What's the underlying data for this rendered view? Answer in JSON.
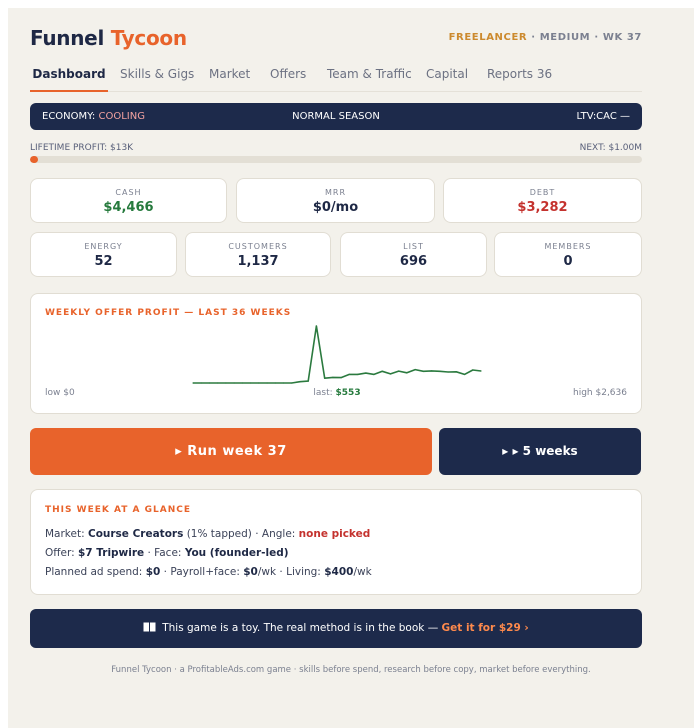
{
  "header": {
    "brand_part1": "Funnel",
    "brand_part2": "Tycoon",
    "career": "FREELANCER",
    "difficulty": "MEDIUM",
    "week": "WK 37"
  },
  "tabs": [
    {
      "label": "Dashboard",
      "active": true
    },
    {
      "label": "Skills & Gigs"
    },
    {
      "label": "Market"
    },
    {
      "label": "Offers"
    },
    {
      "label": "Team & Traffic"
    },
    {
      "label": "Capital"
    },
    {
      "label": "Reports 36"
    }
  ],
  "economy": {
    "prefix": "ECONOMY:",
    "state": "COOLING",
    "season": "NORMAL SEASON",
    "ltv_cac": "LTV:CAC —"
  },
  "lifetime": {
    "left_label": "LIFETIME PROFIT: $13K",
    "right_label": "NEXT: $1.00M",
    "progress_fraction": 0.013
  },
  "stats_top": [
    {
      "label": "CASH",
      "value": "$4,466",
      "tone": "green"
    },
    {
      "label": "MRR",
      "value": "$0/mo",
      "tone": "navy"
    },
    {
      "label": "DEBT",
      "value": "$3,282",
      "tone": "red"
    }
  ],
  "stats_bottom": [
    {
      "label": "ENERGY",
      "value": "52"
    },
    {
      "label": "CUSTOMERS",
      "value": "1,137"
    },
    {
      "label": "LIST",
      "value": "696"
    },
    {
      "label": "MEMBERS",
      "value": "0"
    }
  ],
  "chart_data": {
    "type": "line",
    "title": "WEEKLY OFFER PROFIT — LAST 36 WEEKS",
    "low_label": "low $0",
    "last_prefix": "last:",
    "last_value": "$553",
    "high_label": "high $2,636",
    "ylim": [
      0,
      2636
    ],
    "color": "#2b7a3f",
    "x": [
      1,
      2,
      3,
      4,
      5,
      6,
      7,
      8,
      9,
      10,
      11,
      12,
      13,
      14,
      15,
      16,
      17,
      18,
      19,
      20,
      21,
      22,
      23,
      24,
      25,
      26,
      27,
      28,
      29,
      30,
      31,
      32,
      33,
      34,
      35,
      36
    ],
    "values": [
      0,
      0,
      0,
      0,
      0,
      0,
      0,
      0,
      0,
      0,
      0,
      0,
      0,
      60,
      90,
      2636,
      220,
      260,
      250,
      400,
      400,
      460,
      400,
      540,
      420,
      550,
      470,
      620,
      540,
      560,
      540,
      510,
      520,
      400,
      600,
      553
    ]
  },
  "actions": {
    "run_label": "▸ Run week 37",
    "five_label": "▸ ▸ 5 weeks"
  },
  "glance": {
    "title": "THIS WEEK AT A GLANCE",
    "market_prefix": "Market:",
    "market_value": "Course Creators",
    "market_note": "(1% tapped) · Angle:",
    "angle_value": "none picked",
    "offer_prefix": "Offer:",
    "offer_value": "$7 Tripwire",
    "face_prefix": "· Face:",
    "face_value": "You (founder-led)",
    "spend_prefix": "Planned ad spend:",
    "spend_value": "$0",
    "payroll_prefix": "· Payroll+face:",
    "payroll_value": "$0",
    "payroll_unit": "/wk · Living:",
    "living_value": "$400",
    "living_unit": "/wk"
  },
  "promo": {
    "icon": "book-icon",
    "text": "This game is a toy. The real method is in the book —",
    "cta": "Get it for $29 ›"
  },
  "footer": "Funnel Tycoon · a ProfitableAds.com game · skills before spend, research before copy, market before everything.",
  "colors": {
    "accent": "#e8632b",
    "navy": "#1d2a4b",
    "green": "#267a3d",
    "red": "#c4322e",
    "background": "#f3f1eb"
  }
}
